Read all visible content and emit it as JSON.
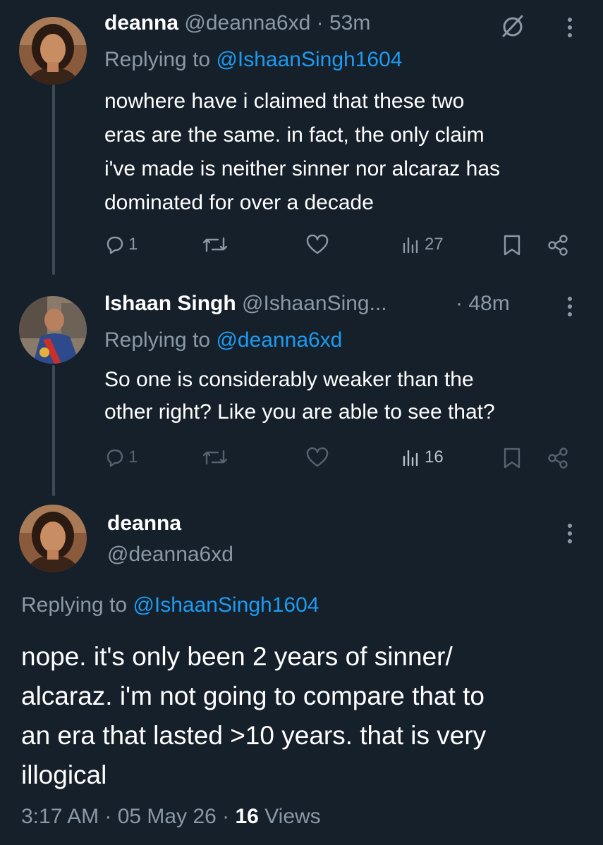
{
  "tweet1": {
    "name": "deanna",
    "handle": "@deanna6xd",
    "sep": "·",
    "time": "53m",
    "replying_prefix": "Replying to",
    "replying_to": "@IshaanSingh1604",
    "text_lines": [
      "nowhere have i claimed that these two",
      "eras are the same. in fact, the only claim",
      "i've made is neither sinner nor alcaraz has",
      "dominated for over a decade"
    ],
    "replies": "1",
    "views": "27"
  },
  "tweet2": {
    "name": "Ishaan Singh",
    "handle": "@IshaanSing...",
    "sep": "·",
    "time": "48m",
    "replying_prefix": "Replying to",
    "replying_to": "@deanna6xd",
    "text_lines": [
      "So one is considerably weaker than the",
      "other right? Like you are able to see that?"
    ],
    "replies": "1",
    "views": "16"
  },
  "main": {
    "name": "deanna",
    "handle": "@deanna6xd",
    "replying_prefix": "Replying to",
    "replying_to": "@IshaanSingh1604",
    "text_lines": [
      "nope. it's only been 2 years of sinner/",
      "alcaraz. i'm not going to compare that to",
      "an era that lasted >10 years. that is very",
      "illogical"
    ],
    "timestamp": "3:17 AM · 05 May 26 ·",
    "views_count": "16",
    "views_label": "Views"
  },
  "colors": {
    "background": "#15202b",
    "accent": "#1d9bf0",
    "muted": "#8b98a5"
  },
  "icons": [
    "grok-icon",
    "more-icon",
    "reply-icon",
    "retweet-icon",
    "like-icon",
    "views-icon",
    "bookmark-icon",
    "share-icon"
  ]
}
